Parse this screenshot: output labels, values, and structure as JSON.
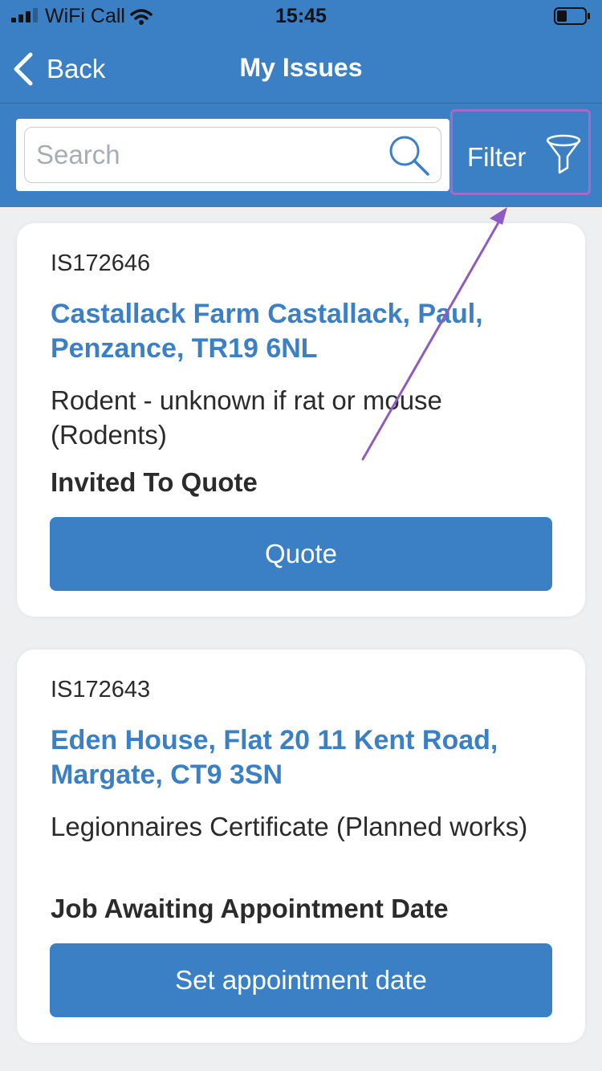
{
  "status_bar": {
    "carrier": "WiFi Call",
    "time": "15:45"
  },
  "header": {
    "back_label": "Back",
    "title": "My Issues"
  },
  "search": {
    "placeholder": "Search",
    "value": ""
  },
  "filter": {
    "label": "Filter"
  },
  "issues": [
    {
      "id": "IS172646",
      "address": "Castallack Farm Castallack, Paul, Penzance, TR19 6NL",
      "description": "Rodent - unknown if rat or mouse (Rodents)",
      "status": "Invited To Quote",
      "action_label": "Quote"
    },
    {
      "id": "IS172643",
      "address": "Eden House, Flat 20 11 Kent Road, Margate, CT9 3SN",
      "description": "Legionnaires Certificate (Planned works)",
      "status": "Job Awaiting Appointment Date",
      "action_label": "Set appointment date"
    }
  ],
  "colors": {
    "primary": "#3b80c4",
    "background": "#eeeff1",
    "annotation": "#8e5cc0"
  },
  "icons": [
    "signal-icon",
    "wifi-icon",
    "battery-icon",
    "back-chevron-icon",
    "search-icon",
    "filter-icon"
  ]
}
